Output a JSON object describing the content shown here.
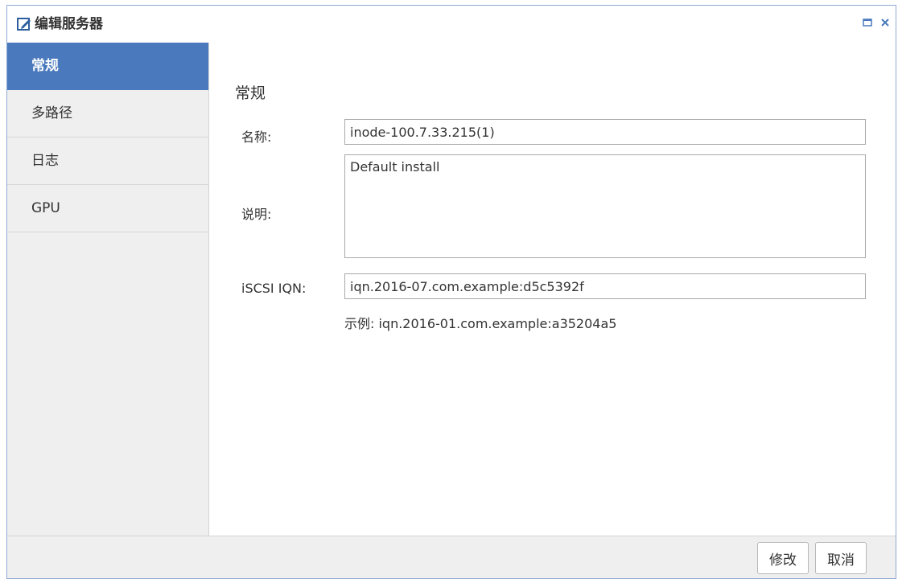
{
  "window": {
    "title": "编辑服务器",
    "icon": "edit-icon",
    "controls": [
      "maximize-icon",
      "close-icon"
    ]
  },
  "sidebar": {
    "items": [
      {
        "label": "常规",
        "active": true
      },
      {
        "label": "多路径",
        "active": false
      },
      {
        "label": "日志",
        "active": false
      },
      {
        "label": "GPU",
        "active": false
      }
    ]
  },
  "main": {
    "section_title": "常规",
    "name_label": "名称:",
    "name_value": "inode-100.7.33.215(1)",
    "desc_label": "说明:",
    "desc_value": "Default install",
    "iqn_label": "iSCSI IQN:",
    "iqn_value": "iqn.2016-07.com.example:d5c5392f",
    "example_text": "示例: iqn.2016-01.com.example:a35204a5"
  },
  "footer": {
    "modify_label": "修改",
    "cancel_label": "取消"
  },
  "colors": {
    "accent": "#4a79bd",
    "border": "#8eaad1"
  }
}
